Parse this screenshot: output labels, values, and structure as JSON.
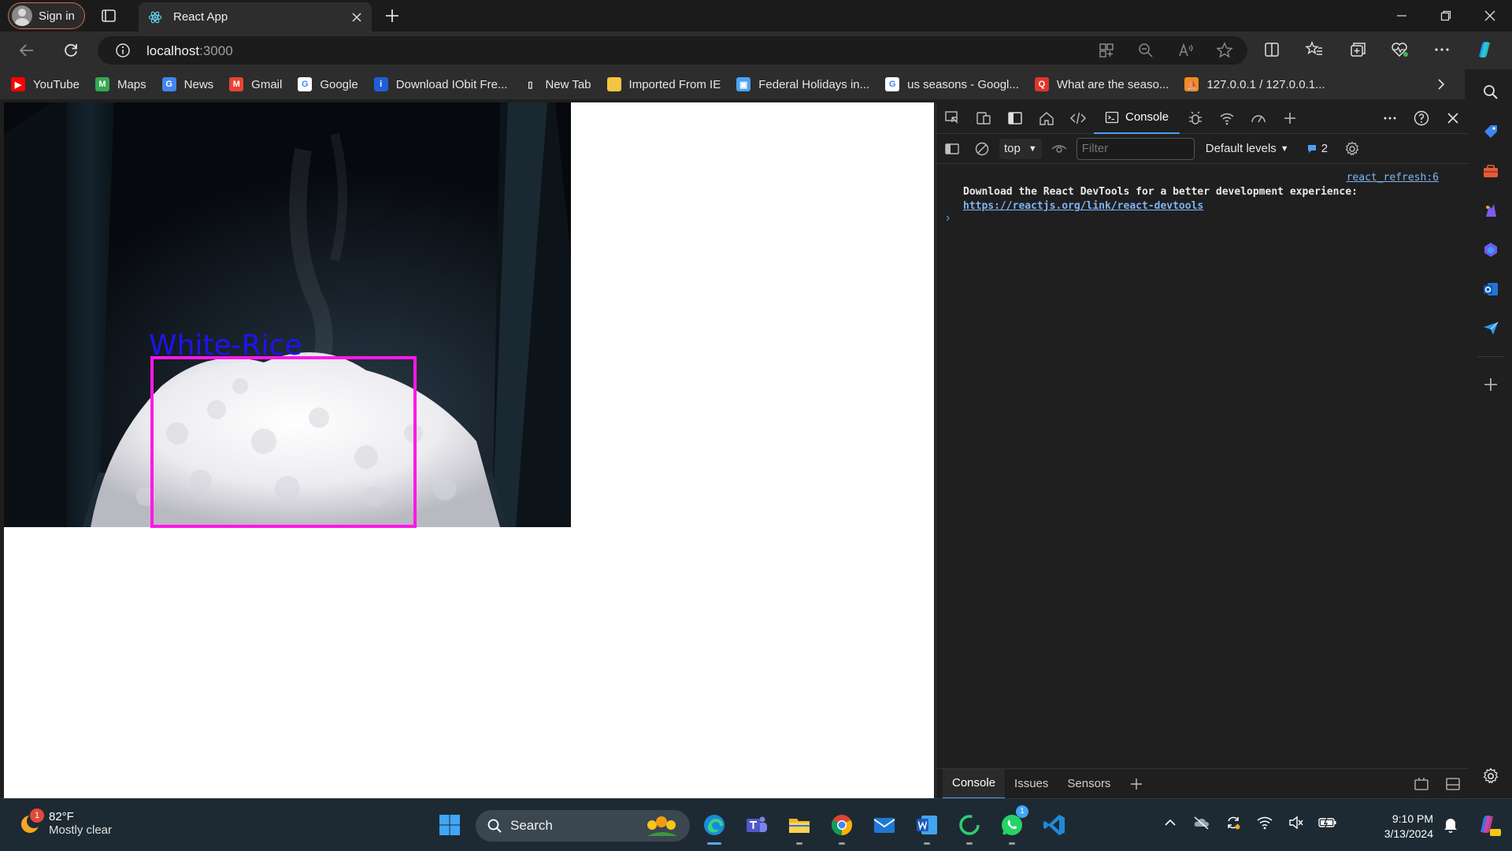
{
  "browser": {
    "signin_label": "Sign in",
    "tab_title": "React App",
    "url_host": "localhost",
    "url_port": ":3000"
  },
  "bookmarks": [
    {
      "label": "YouTube",
      "color": "#ff0000",
      "icon": "youtube-icon",
      "glyph": "▶"
    },
    {
      "label": "Maps",
      "color": "#34a853",
      "icon": "maps-icon",
      "glyph": "M"
    },
    {
      "label": "News",
      "color": "#4285f4",
      "icon": "news-icon",
      "glyph": "G"
    },
    {
      "label": "Gmail",
      "color": "#ea4335",
      "icon": "gmail-icon",
      "glyph": "M"
    },
    {
      "label": "Google",
      "color": "#ffffff",
      "icon": "google-icon",
      "glyph": "G"
    },
    {
      "label": "Download IObit Fre...",
      "color": "#1e5fd6",
      "icon": "iobit-icon",
      "glyph": "i"
    },
    {
      "label": "New Tab",
      "color": "#2d2d2d",
      "icon": "page-icon",
      "glyph": "▯"
    },
    {
      "label": "Imported From IE",
      "color": "#f4c542",
      "icon": "folder-icon",
      "glyph": ""
    },
    {
      "label": "Federal Holidays in...",
      "color": "#4aa3f5",
      "icon": "calendar-icon",
      "glyph": "▣"
    },
    {
      "label": "us seasons - Googl...",
      "color": "#ffffff",
      "icon": "google-icon",
      "glyph": "G"
    },
    {
      "label": "What are the seaso...",
      "color": "#e0352b",
      "icon": "quora-icon",
      "glyph": "Q"
    },
    {
      "label": "127.0.0.1 / 127.0.0.1...",
      "color": "#f08a24",
      "icon": "phpmyadmin-icon",
      "glyph": "⛵"
    }
  ],
  "page": {
    "detection_label": "White-Rice"
  },
  "devtools": {
    "console_tab": "Console",
    "context": "top",
    "filter_placeholder": "Filter",
    "levels": "Default levels",
    "issues_count": "2",
    "message_source": "react_refresh:6",
    "message_text": "Download the React DevTools for a better development experience: ",
    "message_link": "https://reactjs.org/link/react-devtools",
    "drawer_tabs": [
      "Console",
      "Issues",
      "Sensors"
    ]
  },
  "taskbar": {
    "temperature": "82°F",
    "condition": "Mostly clear",
    "weather_badge": "1",
    "search_label": "Search",
    "whatsapp_badge": "1",
    "time": "9:10 PM",
    "date": "3/13/2024"
  }
}
